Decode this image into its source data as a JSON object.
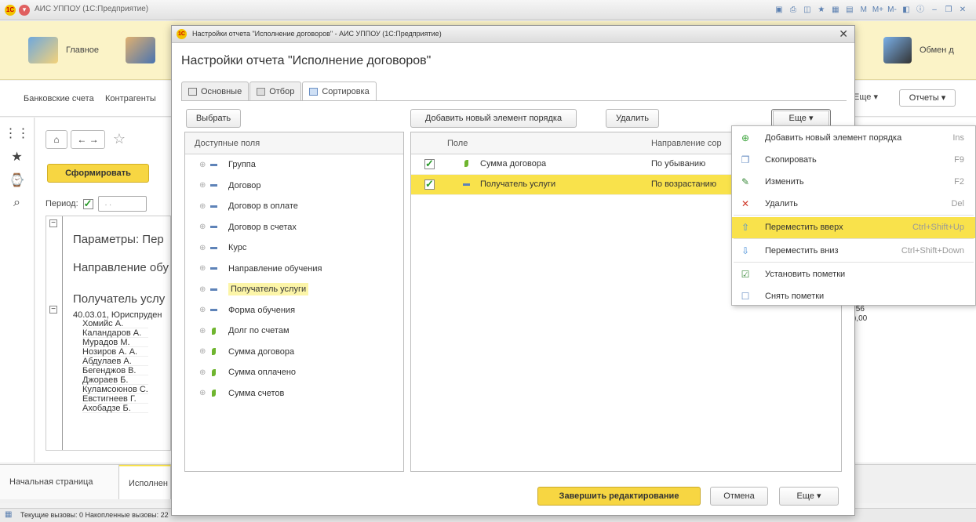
{
  "main_window": {
    "title": "АИС УППОУ (1С:Предприятие)",
    "tools": [
      "M",
      "M+",
      "M-"
    ],
    "sections": [
      "Главное",
      "Обмен д"
    ],
    "subnav": [
      "Банковские счета",
      "Контрагенты",
      "Еще ▾",
      "Отчеты ▾"
    ],
    "form_button": "Сформировать",
    "period_label": "Период:",
    "period_value": ". .",
    "report": {
      "params": "Параметры:  Пер",
      "direction": "Направление обу",
      "recipient": "Получатель услу",
      "group_header": "40.03.01, Юриспруден",
      "rows": [
        "Хомийс А.",
        "Каландаров А.",
        "Мурадов М.",
        "Нозиров А. А.",
        "Абдулаев А.",
        "Бегенджов В.",
        "Джораев Б.",
        "Куламсоюнов С.",
        "Евстигнеев Г.",
        "Ахобадзе Б."
      ]
    },
    "right_numbers": [
      ",56",
      "),00"
    ],
    "bottom_tabs": [
      "Начальная страница",
      "Исполнен"
    ],
    "status": "Текущие вызовы: 0   Накопленные вызовы: 22"
  },
  "dialog": {
    "window_title": "Настройки отчета \"Исполнение договоров\" - АИС УППОУ  (1С:Предприятие)",
    "heading": "Настройки отчета \"Исполнение договоров\"",
    "tabs": [
      "Основные",
      "Отбор",
      "Сортировка"
    ],
    "choose_button": "Выбрать",
    "add_button": "Добавить новый элемент порядка",
    "delete_button": "Удалить",
    "more_button": "Еще",
    "available_fields_header": "Доступные поля",
    "available_fields": [
      {
        "label": "Группа",
        "kind": "attr"
      },
      {
        "label": "Договор",
        "kind": "attr"
      },
      {
        "label": "Договор в оплате",
        "kind": "attr"
      },
      {
        "label": "Договор в счетах",
        "kind": "attr"
      },
      {
        "label": "Курс",
        "kind": "attr"
      },
      {
        "label": "Направление обучения",
        "kind": "attr"
      },
      {
        "label": "Получатель услуги",
        "kind": "attr",
        "highlight": true
      },
      {
        "label": "Форма обучения",
        "kind": "attr"
      },
      {
        "label": "Долг по счетам",
        "kind": "resource"
      },
      {
        "label": "Сумма договора",
        "kind": "resource"
      },
      {
        "label": "Сумма оплачено",
        "kind": "resource"
      },
      {
        "label": "Сумма счетов",
        "kind": "resource"
      }
    ],
    "sort_columns": {
      "field": "Поле",
      "direction": "Направление сор"
    },
    "sort_rows": [
      {
        "field": "Сумма договора",
        "direction": "По убыванию",
        "checked": true,
        "kind": "resource"
      },
      {
        "field": "Получатель услуги",
        "direction": "По возрастанию",
        "checked": true,
        "kind": "attr",
        "selected": true
      }
    ],
    "finish_button": "Завершить редактирование",
    "cancel_button": "Отмена",
    "bottom_more_button": "Еще"
  },
  "context_menu": [
    {
      "label": "Добавить новый элемент порядка",
      "shortcut": "Ins",
      "icon": "add-icon",
      "icon_color": "#3ba33b"
    },
    {
      "label": "Скопировать",
      "shortcut": "F9",
      "icon": "copy-icon",
      "icon_color": "#6a8fc4"
    },
    {
      "label": "Изменить",
      "shortcut": "F2",
      "icon": "edit-icon",
      "icon_color": "#3a8a3a"
    },
    {
      "label": "Удалить",
      "shortcut": "Del",
      "icon": "delete-icon",
      "icon_color": "#d03a2a"
    },
    {
      "label": "Переместить вверх",
      "shortcut": "Ctrl+Shift+Up",
      "icon": "move-up-icon",
      "icon_color": "#4a90d9",
      "highlight": true
    },
    {
      "label": "Переместить вниз",
      "shortcut": "Ctrl+Shift+Down",
      "icon": "move-down-icon",
      "icon_color": "#4a90d9"
    },
    {
      "label": "Установить пометки",
      "shortcut": "",
      "icon": "check-all-icon",
      "icon_color": "#3a8a3a"
    },
    {
      "label": "Снять пометки",
      "shortcut": "",
      "icon": "uncheck-all-icon",
      "icon_color": "#6a8fc4"
    }
  ],
  "colors": {
    "accent_yellow": "#f9e24b",
    "button_yellow": "#f7d642",
    "section_bg": "#fbf3c7"
  }
}
